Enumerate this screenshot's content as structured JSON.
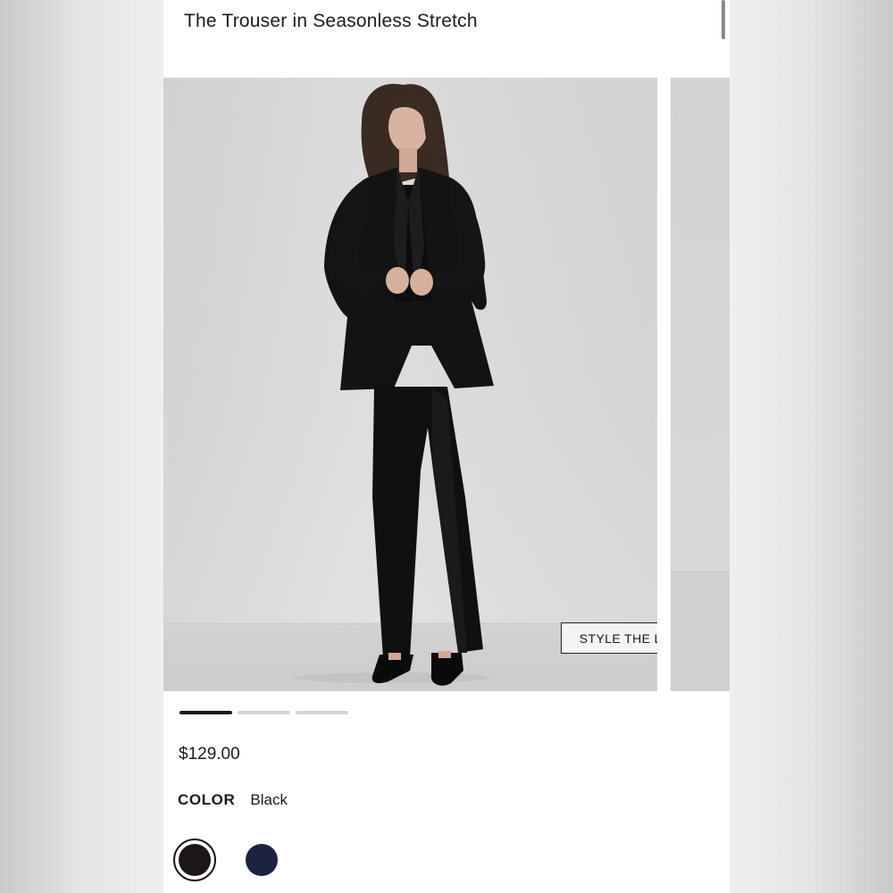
{
  "product": {
    "title": "The Trouser in Seasonless Stretch",
    "price": "$129.00"
  },
  "carousel": {
    "slide_count": 3,
    "active_index": 0,
    "style_the_look_label": "STYLE THE LOOK"
  },
  "color": {
    "label": "COLOR",
    "selected_name": "Black",
    "swatches": [
      {
        "name": "Black",
        "hex": "#1b1718",
        "selected": true
      },
      {
        "name": "navy",
        "hex": "#1c2340",
        "selected": false
      }
    ]
  }
}
